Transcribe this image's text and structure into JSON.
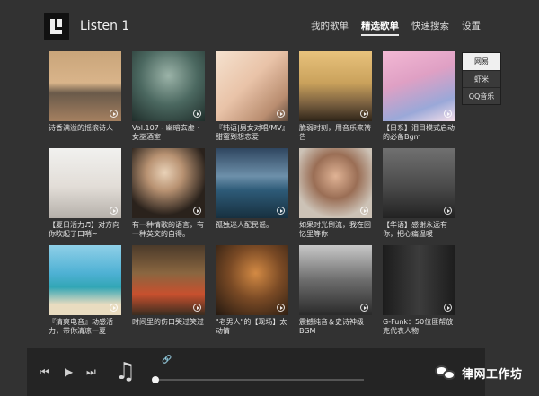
{
  "app": {
    "title": "Listen 1"
  },
  "nav": {
    "items": [
      "我的歌单",
      "精选歌单",
      "快速搜索",
      "设置"
    ],
    "active_index": 1
  },
  "sources": {
    "items": [
      "网易",
      "虾米",
      "QQ音乐"
    ],
    "selected_index": 0
  },
  "playlists": [
    {
      "caption": "诗香满溢的摇滚诗人",
      "icon": "play-circle-icon"
    },
    {
      "caption": "Vol.107 - 幽暗玄虚 · 女巫酒室",
      "icon": "play-circle-icon"
    },
    {
      "caption": "『韩语|男女对唱/MV』甜蜜到想恋爱",
      "icon": "play-circle-icon"
    },
    {
      "caption": "脆弱时刻，用音乐来祷告",
      "icon": "play-circle-icon"
    },
    {
      "caption": "【日系】泪目模式启动的必备Bgm",
      "icon": "play-circle-icon"
    },
    {
      "caption": "【夏日活力♬】对方向你吹起了口哨~",
      "icon": "play-circle-icon"
    },
    {
      "caption": "有一种情歌的语言，有一种英文的自得。",
      "icon": "play-circle-icon"
    },
    {
      "caption": "孤独迷人配民谣。",
      "icon": "play-circle-icon"
    },
    {
      "caption": "如果时光倒流，我在回忆里等你",
      "icon": "play-circle-icon"
    },
    {
      "caption": "【华语】感谢永远有你，把心痛温暖",
      "icon": "play-circle-icon"
    },
    {
      "caption": "『清爽电音』动感活力，带你清凉一夏",
      "icon": "play-circle-icon"
    },
    {
      "caption": "时间里的伤口哭过笑过",
      "icon": "play-circle-icon"
    },
    {
      "caption": "\"老男人\"的【现场】太动情",
      "icon": "play-circle-icon"
    },
    {
      "caption": "震撼纯音＆史诗神级BGM",
      "icon": "play-circle-icon"
    },
    {
      "caption": "G-Funk：50位匪帮放克代表人物",
      "icon": "play-circle-icon"
    }
  ],
  "player": {
    "prev_icon": "⏮",
    "play_icon": "▶",
    "next_icon": "⏭",
    "note_icon": "♫",
    "link_icon": "🔗",
    "progress": 0.0
  },
  "watermark": {
    "text": "律网工作坊"
  }
}
